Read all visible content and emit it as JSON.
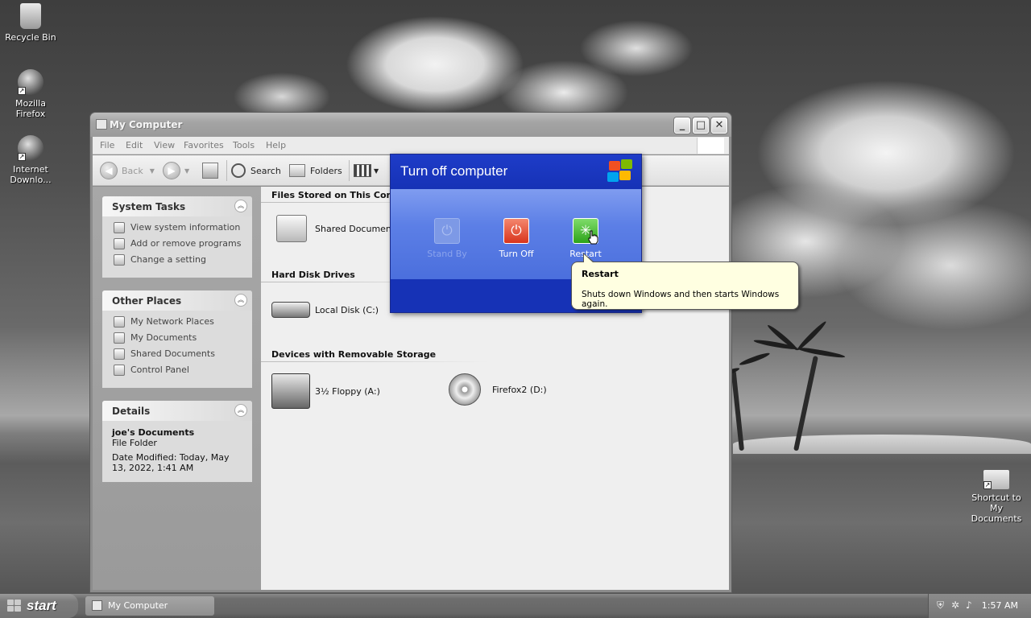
{
  "desktop": {
    "icons": [
      {
        "label": "Recycle Bin"
      },
      {
        "label": "Mozilla Firefox"
      },
      {
        "label": "Internet Downlo..."
      },
      {
        "label": "Shortcut to My Documents"
      }
    ]
  },
  "window": {
    "title": "My Computer",
    "menu": [
      "File",
      "Edit",
      "View",
      "Favorites",
      "Tools",
      "Help"
    ],
    "toolbar": {
      "back": "Back",
      "search": "Search",
      "folders": "Folders"
    },
    "sidebar": {
      "system_tasks": {
        "title": "System Tasks",
        "items": [
          "View system information",
          "Add or remove programs",
          "Change a setting"
        ]
      },
      "other_places": {
        "title": "Other Places",
        "items": [
          "My Network Places",
          "My Documents",
          "Shared Documents",
          "Control Panel"
        ]
      },
      "details": {
        "title": "Details",
        "name": "joe's Documents",
        "type": "File Folder",
        "modified": "Date Modified: Today, May 13, 2022, 1:41 AM"
      }
    },
    "groups": {
      "files_stored": {
        "title": "Files Stored on This Compu",
        "items": [
          "Shared Documents"
        ]
      },
      "hard_disks": {
        "title": "Hard Disk Drives",
        "items": [
          "Local Disk (C:)"
        ]
      },
      "removable": {
        "title": "Devices with Removable Storage",
        "items": [
          "3½ Floppy (A:)",
          "Firefox2 (D:)"
        ]
      }
    }
  },
  "dialog": {
    "title": "Turn off computer",
    "buttons": {
      "stand_by": "Stand By",
      "turn_off": "Turn Off",
      "restart": "Restart"
    }
  },
  "tooltip": {
    "title": "Restart",
    "body": "Shuts down Windows and then starts Windows again."
  },
  "taskbar": {
    "start": "start",
    "task": "My Computer",
    "clock": "1:57 AM"
  }
}
